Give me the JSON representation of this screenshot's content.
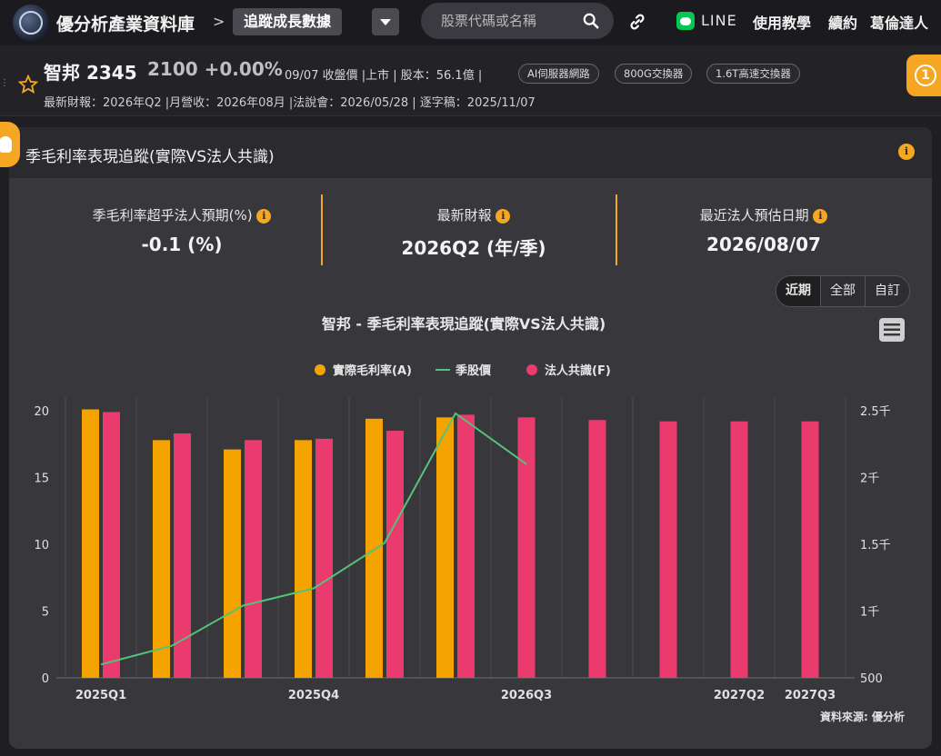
{
  "nav": {
    "brand": "優分析產業資料庫",
    "crumb_sep": ">",
    "current_page": "追蹤成長數據",
    "search_placeholder": "股票代碼或名稱",
    "line_label": "LINE",
    "items": [
      "使用教學",
      "續約",
      "葛倫達人"
    ]
  },
  "stock": {
    "name": "智邦 2345",
    "price": "2100 +0.00%",
    "meta": "09/07 收盤價 |上市 | 股本：56.1億 |",
    "tags": [
      "AI伺服器網路",
      "800G交換器",
      "1.6T高速交換器"
    ],
    "sub": "最新財報：2026年Q2 |月營收：2026年08月 |法說會：2026/05/28 | 逐字稿：2025/11/07",
    "notif_count": "1"
  },
  "card": {
    "title": "季毛利率表現追蹤(實際VS法人共識)",
    "stats": [
      {
        "label": "季毛利率超乎法人預期(%)",
        "value": "-0.1 (%)"
      },
      {
        "label": "最新財報",
        "value": "2026Q2 (年/季)"
      },
      {
        "label": "最近法人預估日期",
        "value": "2026/08/07"
      }
    ],
    "ranges": [
      "近期",
      "全部",
      "自訂"
    ],
    "source": "資料來源: 優分析"
  },
  "colors": {
    "actual": "#f5a300",
    "consensus": "#ea3a6e",
    "price": "#55c27a",
    "accent": "#f5a623"
  },
  "chart_data": {
    "type": "bar",
    "title": "智邦 - 季毛利率表現追蹤(實際VS法人共識)",
    "categories": [
      "2025Q1",
      "2025Q2",
      "2025Q3",
      "2025Q4",
      "2026Q1",
      "2026Q2",
      "2026Q3",
      "2026Q4",
      "2027Q1",
      "2027Q2",
      "2027Q3"
    ],
    "x_tick_labels": [
      "2025Q1",
      "2025Q4",
      "2026Q3",
      "2027Q2",
      "2027Q3"
    ],
    "series": [
      {
        "name": "實際毛利率(A)",
        "type": "bar",
        "axis": "left",
        "values": [
          20.1,
          17.8,
          17.1,
          17.8,
          19.4,
          19.5,
          null,
          null,
          null,
          null,
          null
        ]
      },
      {
        "name": "季股價",
        "type": "line",
        "axis": "right",
        "values": [
          600,
          740,
          1040,
          1170,
          1510,
          2480,
          2100,
          null,
          null,
          null,
          null
        ]
      },
      {
        "name": "法人共識(F)",
        "type": "bar",
        "axis": "left",
        "values": [
          19.9,
          18.3,
          17.8,
          17.9,
          18.5,
          19.7,
          19.5,
          19.3,
          19.2,
          19.2,
          19.2
        ]
      }
    ],
    "ylim": [
      0,
      20
    ],
    "y_ticks": [
      "0",
      "5",
      "10",
      "15",
      "20"
    ],
    "y2lim": [
      500,
      2500
    ],
    "y2_ticks": [
      "500",
      "1千",
      "1.5千",
      "2千",
      "2.5千"
    ],
    "legend_position": "top-center"
  }
}
